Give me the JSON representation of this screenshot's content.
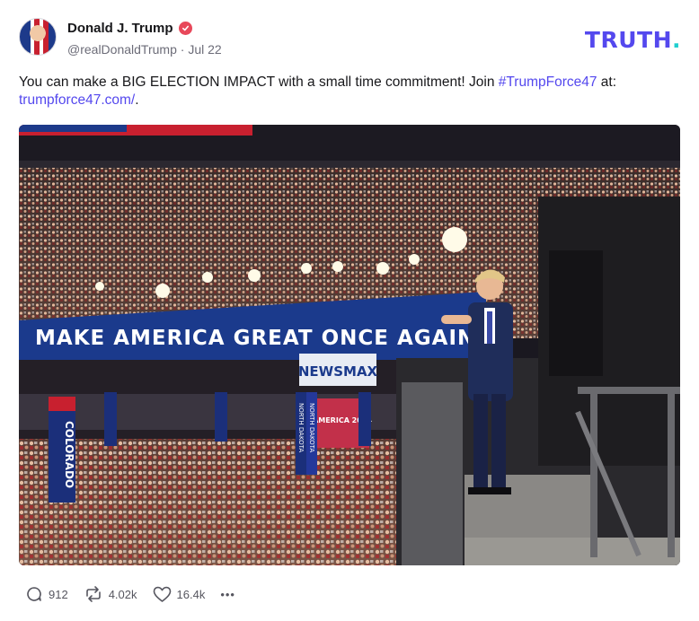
{
  "author": {
    "display_name": "Donald J. Trump",
    "handle": "@realDonaldTrump",
    "separator": " · ",
    "date": "Jul 22"
  },
  "brand": {
    "logo_main": "TRUTH",
    "logo_dot": "."
  },
  "post": {
    "text_before": "You can make a BIG ELECTION IMPACT with a small time commitment! Join ",
    "hashtag": "#TrumpForce47",
    "text_middle": " at: ",
    "link": "trumpforce47.com/",
    "text_after": "."
  },
  "image": {
    "banner_text": "MAKE AMERICA GREAT ONCE AGAIN",
    "sign_newsmax": "NEWSMAX",
    "sign_colorado": "COLORADO",
    "sign_north_dakota_1": "NORTH DAKOTA",
    "sign_north_dakota_2": "NORTH DAKOTA",
    "screen_text": "AMERICA 2024"
  },
  "actions": {
    "replies": "912",
    "retruths": "4.02k",
    "likes": "16.4k",
    "more": "•••"
  },
  "colors": {
    "accent": "#5448ee",
    "verified": "#e8485a",
    "logo_dot": "#1fcfd0",
    "banner_blue": "#1b3a8c"
  }
}
